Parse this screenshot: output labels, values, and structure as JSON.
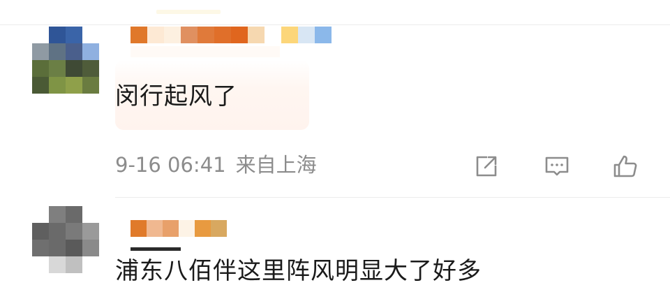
{
  "comments": [
    {
      "text": "闵行起风了",
      "time": "9-16 06:41",
      "location": "来自上海",
      "avatar_colors": [
        "#ffffff",
        "#2f5597",
        "#3a64a8",
        "#ffffff",
        "#8f9aa3",
        "#5f7284",
        "#4a5f8c",
        "#8fb0e0",
        "#5b6e3a",
        "#6b7f45",
        "#3f4a35",
        "#4f5c3a",
        "#4a5a35",
        "#7f9445",
        "#8fa04a",
        "#6a7c40"
      ],
      "username_colors": [
        "#e0782a",
        "#fde9d4",
        "#fdf0e0",
        "#e09060",
        "#e07a3a",
        "#e06f2a",
        "#e0661e",
        "#f6d8b0",
        "#ffffff",
        "#fcd67a",
        "#d8e6f4",
        "#8bb8ea"
      ]
    },
    {
      "text": "浦东八佰伴这里阵风明显大了好多",
      "avatar_colors": [
        "#ffffff",
        "#7f7f7f",
        "#6a6a6a",
        "#ffffff",
        "#5f5f5f",
        "#6a6a6a",
        "#7a7a7a",
        "#9a9a9a",
        "#6f6f6f",
        "#6a6a6a",
        "#5a5a5a",
        "#8a8a8a",
        "#ffffff",
        "#d8d8d8",
        "#c0c0c0",
        "#ffffff"
      ],
      "username_colors": [
        "#e07a2a",
        "#f0b890",
        "#e8a06a",
        "#fdf3e6",
        "#e89a40",
        "#d8a860"
      ]
    }
  ],
  "icons": {
    "share": "share-icon",
    "reply": "comment-icon",
    "like": "thumbs-up-icon"
  }
}
